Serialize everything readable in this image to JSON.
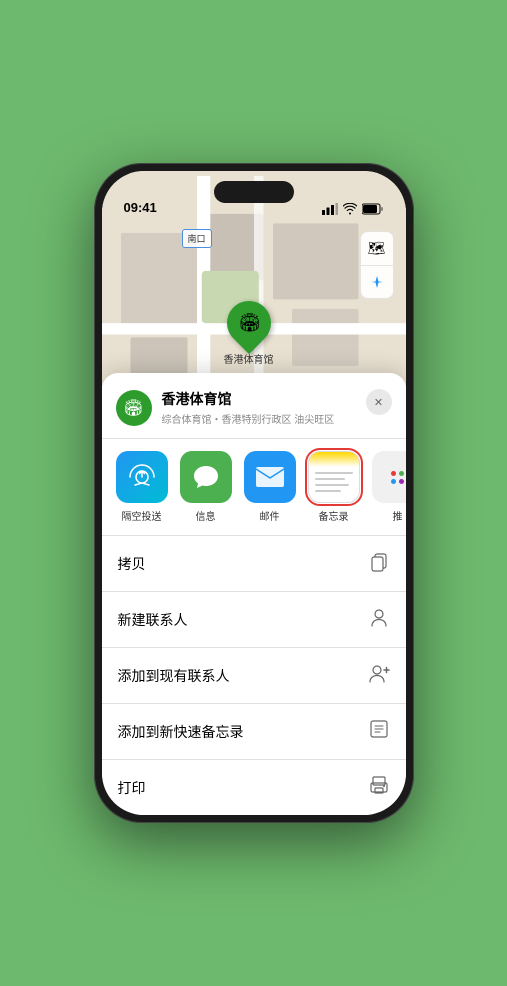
{
  "status": {
    "time": "09:41",
    "location_arrow": "▲"
  },
  "map": {
    "label_nankou": "南口",
    "map_type_icon": "🗺",
    "location_icon": "⊙",
    "marker_label": "香港体育馆",
    "marker_emoji": "🏟"
  },
  "venue": {
    "name": "香港体育馆",
    "subtitle": "综合体育馆・香港特别行政区 油尖旺区",
    "close_label": "✕"
  },
  "share_apps": [
    {
      "id": "airdrop",
      "label": "隔空投送",
      "icon": "📡"
    },
    {
      "id": "messages",
      "label": "信息",
      "icon": "💬"
    },
    {
      "id": "mail",
      "label": "邮件",
      "icon": "✉"
    },
    {
      "id": "notes",
      "label": "备忘录",
      "icon": "notes",
      "selected": true
    }
  ],
  "more_dots": {
    "colors": [
      "#e53935",
      "#4caf50",
      "#2196f3"
    ]
  },
  "actions": [
    {
      "id": "copy",
      "label": "拷贝",
      "icon": "⎘"
    },
    {
      "id": "new-contact",
      "label": "新建联系人",
      "icon": "👤"
    },
    {
      "id": "add-existing",
      "label": "添加到现有联系人",
      "icon": "👤+"
    },
    {
      "id": "add-note",
      "label": "添加到新快速备忘录",
      "icon": "🗒"
    },
    {
      "id": "print",
      "label": "打印",
      "icon": "🖨"
    }
  ]
}
